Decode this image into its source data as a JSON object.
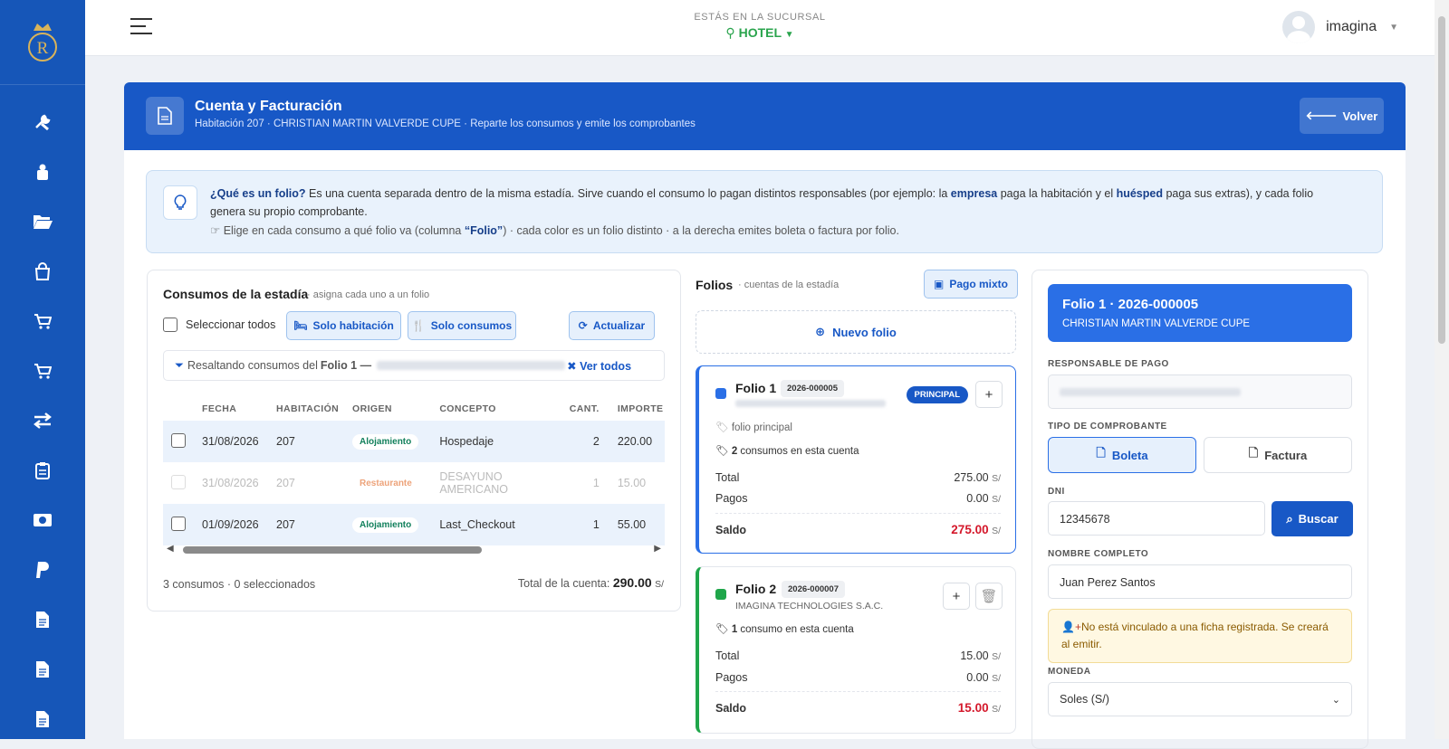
{
  "topbar": {
    "branch_label": "ESTÁS EN LA SUCURSAL",
    "branch_value": "HOTEL",
    "user": "imagina"
  },
  "header": {
    "title": "Cuenta y Facturación",
    "subtitle": "Habitación 207 · CHRISTIAN MARTIN VALVERDE CUPE · Reparte los consumos y emite los comprobantes",
    "back": "Volver"
  },
  "info": {
    "q": "¿Qué es un folio?",
    "t1": " Es una cuenta separada dentro de la misma estadía. Sirve cuando el consumo lo pagan distintos responsables (por ejemplo: la ",
    "b1": "empresa",
    "t2": " paga la habitación y el ",
    "b2": "huésped",
    "t3": " paga sus extras), y cada folio genera su propio comprobante.",
    "h1": "Elige en cada consumo a qué folio va (columna ",
    "hb": "“Folio”",
    "h2": ") · cada color es un folio distinto · a la derecha emites boleta o factura por folio."
  },
  "consumos": {
    "title": "Consumos de la estadía",
    "sub": "· asigna cada uno a un folio",
    "select_all": "Seleccionar todos",
    "btn_hab": "Solo habitación",
    "btn_cons": "Solo consumos",
    "btn_upd": "Actualizar",
    "filter_a": "Resaltando consumos del ",
    "filter_b": "Folio 1 —",
    "filter_all": "Ver todos",
    "cols": [
      "FECHA",
      "HABITACIÓN",
      "ORIGEN",
      "CONCEPTO",
      "CANT.",
      "IMPORTE"
    ],
    "rows": [
      {
        "fecha": "31/08/2026",
        "hab": "207",
        "origen": "Alojamiento",
        "concepto": "Hospedaje",
        "cant": "2",
        "imp": "220.00"
      },
      {
        "fecha": "31/08/2026",
        "hab": "207",
        "origen": "Restaurante",
        "concepto": "DESAYUNO AMERICANO",
        "cant": "1",
        "imp": "15.00"
      },
      {
        "fecha": "01/09/2026",
        "hab": "207",
        "origen": "Alojamiento",
        "concepto": "Last_Checkout",
        "cant": "1",
        "imp": "55.00"
      }
    ],
    "count": "3 consumos · 0 seleccionados",
    "total_label": "Total de la cuenta:",
    "total": "290.00",
    "currency": "S/"
  },
  "folios": {
    "title": "Folios",
    "sub": "· cuentas de la estadía",
    "mixed": "Pago mixto",
    "new": "Nuevo folio",
    "f1": {
      "name": "Folio 1",
      "code": "2026-000005",
      "badge": "PRINCIPAL",
      "tag": "folio principal",
      "count": "2",
      "count_text": " consumos en esta cuenta",
      "total_label": "Total",
      "total": "275.00",
      "pagos_label": "Pagos",
      "pagos": "0.00",
      "saldo_label": "Saldo",
      "saldo": "275.00",
      "cur": "S/",
      "color": "#2a6fe6"
    },
    "f2": {
      "name": "Folio 2",
      "code": "2026-000007",
      "owner": "IMAGINA TECHNOLOGIES S.A.C.",
      "count": "1",
      "count_text": " consumo en esta cuenta",
      "total_label": "Total",
      "total": "15.00",
      "pagos_label": "Pagos",
      "pagos": "0.00",
      "saldo_label": "Saldo",
      "saldo": "15.00",
      "cur": "S/",
      "color": "#1fa64a"
    }
  },
  "billing": {
    "title": "Folio 1 · 2026-000005",
    "owner": "CHRISTIAN MARTIN VALVERDE CUPE",
    "resp_label": "RESPONSABLE DE PAGO",
    "tipo_label": "TIPO DE COMPROBANTE",
    "boleta": "Boleta",
    "factura": "Factura",
    "dni_label": "DNI",
    "dni": "12345678",
    "buscar": "Buscar",
    "name_label": "NOMBRE COMPLETO",
    "name": "Juan Perez Santos",
    "warn": "No está vinculado a una ficha registrada. Se creará al emitir.",
    "moneda_label": "MONEDA",
    "moneda": "Soles (S/)"
  }
}
